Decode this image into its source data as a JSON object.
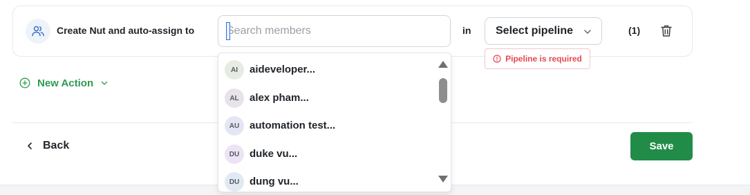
{
  "action": {
    "icon": "users-icon",
    "label": "Create Nut and auto-assign to",
    "search": {
      "placeholder": "Search members",
      "value": ""
    },
    "in_label": "in",
    "pipeline": {
      "selected": "Select pipeline",
      "icon": "chevron-down-icon"
    },
    "count": "(1)",
    "delete_icon": "trash-icon",
    "error": {
      "icon": "alert-circle-icon",
      "text": "Pipeline is required"
    }
  },
  "new_action": {
    "icon": "plus-circle-icon",
    "label": "New Action",
    "chevron": "chevron-down-icon"
  },
  "footer": {
    "back_label": "Back",
    "back_icon": "chevron-left-icon",
    "save_label": "Save"
  },
  "members": [
    {
      "initials": "AI",
      "name": "aideveloper...",
      "avatar_color": "#e6ece1"
    },
    {
      "initials": "AL",
      "name": "alex pham...",
      "avatar_color": "#e8e3ea"
    },
    {
      "initials": "AU",
      "name": "automation test...",
      "avatar_color": "#e5e6f4"
    },
    {
      "initials": "DU",
      "name": "duke vu...",
      "avatar_color": "#ece3f4"
    },
    {
      "initials": "DU",
      "name": "dung vu...",
      "avatar_color": "#e1e9f3"
    }
  ],
  "colors": {
    "accent_green": "#2e9a52",
    "save_green": "#218c48",
    "error_red": "#e5484d",
    "icon_blue": "#3b6fc4"
  }
}
